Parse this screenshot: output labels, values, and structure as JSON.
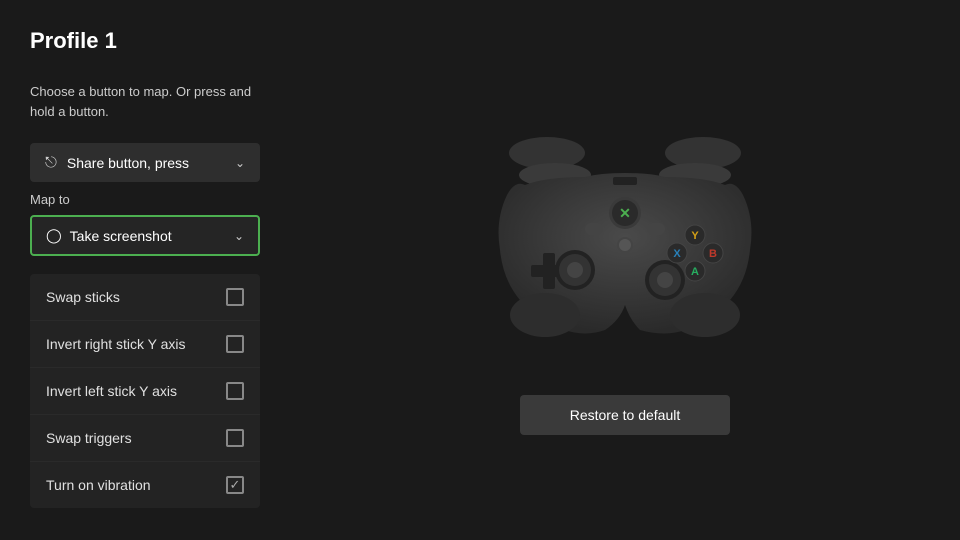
{
  "page": {
    "title": "Profile 1",
    "instruction": "Choose a button to map. Or press and hold a button.",
    "share_button_label": "Share button, press",
    "map_to_label": "Map to",
    "active_mapping": "Take screenshot",
    "restore_button_label": "Restore to default",
    "options": [
      {
        "id": "swap-sticks",
        "label": "Swap sticks",
        "checked": false
      },
      {
        "id": "invert-right",
        "label": "Invert right stick Y axis",
        "checked": false
      },
      {
        "id": "invert-left",
        "label": "Invert left stick Y axis",
        "checked": false
      },
      {
        "id": "swap-triggers",
        "label": "Swap triggers",
        "checked": false
      },
      {
        "id": "vibration",
        "label": "Turn on vibration",
        "checked": true
      }
    ]
  }
}
